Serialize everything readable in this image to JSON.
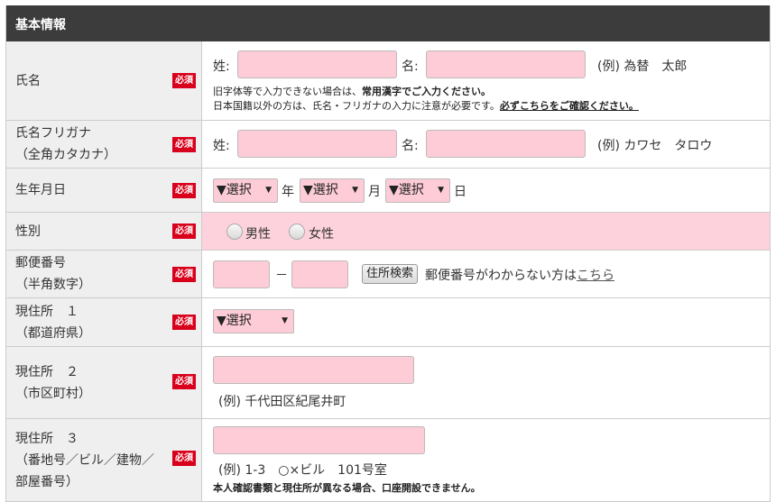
{
  "header": {
    "title": "基本情報"
  },
  "required_label": "必須",
  "name": {
    "label": "氏名",
    "last_label": "姓:",
    "first_label": "名:",
    "example": "(例) 為替　太郎",
    "note1_prefix": "旧字体等で入力できない場合は、",
    "note1_bold": "常用漢字でご入力ください。",
    "note2_prefix": "日本国籍以外の方は、氏名・フリガナの入力に注意が必要です。",
    "note2_link": "必ずこちらをご確認ください。"
  },
  "kana": {
    "label1": "氏名フリガナ",
    "label2": "（全角カタカナ）",
    "last_label": "姓:",
    "first_label": "名:",
    "example": "(例) カワセ　タロウ"
  },
  "birth": {
    "label": "生年月日",
    "select_value": "▼選択",
    "year": "年",
    "month": "月",
    "day": "日"
  },
  "gender": {
    "label": "性別",
    "male": "男性",
    "female": "女性"
  },
  "zip": {
    "label1": "郵便番号",
    "label2": "（半角数字）",
    "dash": "－",
    "search_button": "住所検索",
    "help_prefix": "郵便番号がわからない方は",
    "help_link": "こちら"
  },
  "pref": {
    "label1": "現住所　１",
    "label2": "（都道府県）",
    "select_value": "▼選択"
  },
  "city": {
    "label1": "現住所　２",
    "label2": "（市区町村）",
    "example": "(例) 千代田区紀尾井町"
  },
  "addr3": {
    "label1": "現住所　３",
    "label2": "（番地号／ビル／建物／",
    "label3": "部屋番号）",
    "example": "(例) 1-3　○×ビル　101号室",
    "note": "本人確認書類と現住所が異なる場合、口座開設できません。"
  }
}
